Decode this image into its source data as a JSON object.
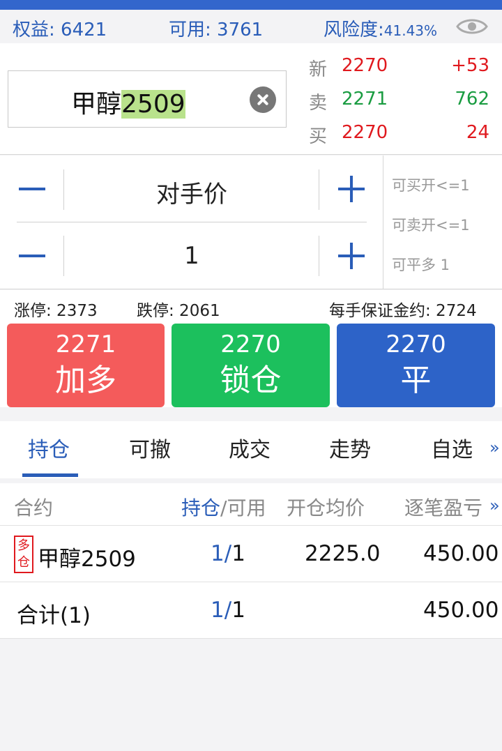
{
  "account": {
    "equity_label": "权益:",
    "equity_value": "6421",
    "available_label": "可用:",
    "available_value": "3761",
    "risk_label": "风险度:",
    "risk_value": "41.43%",
    "visibility_icon": "eye-icon"
  },
  "contract": {
    "name_prefix": "甲醇",
    "name_code": "2509",
    "clear_icon": "clear-icon"
  },
  "quote": {
    "last": {
      "label": "新",
      "price": "2270",
      "change": "+53"
    },
    "ask": {
      "label": "卖",
      "price": "2271",
      "volume": "762"
    },
    "bid": {
      "label": "买",
      "price": "2270",
      "volume": "24"
    }
  },
  "order": {
    "price_type": "对手价",
    "quantity": "1",
    "can_buy_open": "可买开<=1",
    "can_sell_open": "可卖开<=1",
    "can_close_long": "可平多 1"
  },
  "limits": {
    "limit_up": "涨停: 2373",
    "limit_down": "跌停: 2061",
    "margin": "每手保证金约: 2724"
  },
  "actions": {
    "buy": {
      "price": "2271",
      "label": "加多"
    },
    "lock": {
      "price": "2270",
      "label": "锁仓"
    },
    "close": {
      "price": "2270",
      "label": "平"
    }
  },
  "tabs": [
    "持仓",
    "可撤",
    "成交",
    "走势",
    "自选"
  ],
  "tabs_more": "»",
  "positions": {
    "headers": {
      "contract": "合约",
      "position_a": "持仓",
      "position_b": "/可用",
      "avg_price": "开仓均价",
      "pnl": "逐笔盈亏",
      "more": "»"
    },
    "rows": [
      {
        "badge_top": "多",
        "badge_bottom": "仓",
        "contract": "甲醇2509",
        "pos": "1",
        "sep": "/",
        "avail": "1",
        "avg_price": "2225.0",
        "pnl": "450.00"
      }
    ],
    "total": {
      "label": "合计(1)",
      "pos": "1",
      "sep": "/",
      "avail": "1",
      "pnl": "450.00"
    }
  },
  "colors": {
    "primary": "#2a5db8",
    "up": "#e0191e",
    "down": "#1a9c41",
    "buy_button": "#f45b5b",
    "lock_button": "#1cc05d",
    "close_button": "#2d63c8"
  }
}
